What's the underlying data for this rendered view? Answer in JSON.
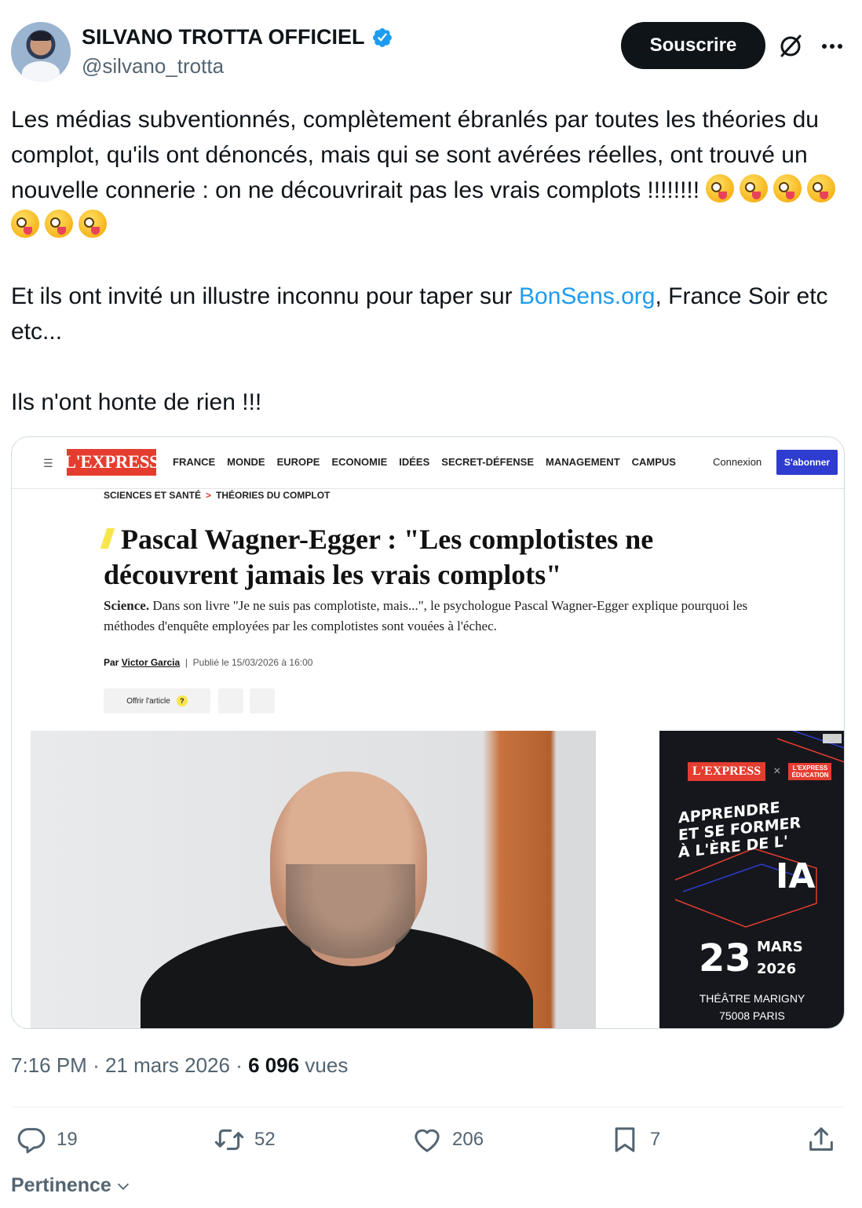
{
  "author": {
    "display_name": "SILVANO TROTTA OFFICIEL",
    "handle": "@silvano_trotta",
    "subscribe_label": "Souscrire"
  },
  "icons": {
    "verified": "verified-badge-icon",
    "grok": "grok-icon",
    "more": "more-icon",
    "reply": "reply-icon",
    "repost": "repost-icon",
    "like": "like-icon",
    "bookmark": "bookmark-icon",
    "share": "share-icon"
  },
  "colors": {
    "link": "#1d9bf0",
    "text": "#0f1419",
    "muted": "#536471",
    "button": "#0f1419"
  },
  "tweet": {
    "para1": "Les médias subventionnés, complètement ébranlés par toutes les théories du complot, qu'ils ont dénoncés, mais qui se sont avérées réelles, ont trouvé un nouvelle connerie : on ne découvrirait pas les vrais complots !!!!!!!!",
    "emoji_count": 7,
    "para2_before": "Et ils ont invité un illustre inconnu pour taper sur ",
    "para2_link": "BonSens.org",
    "para2_after": ", France Soir etc etc...",
    "para3": "Ils n'ont honte de rien !!!"
  },
  "article": {
    "logo": "L'EXPRESS",
    "nav": [
      "FRANCE",
      "MONDE",
      "EUROPE",
      "ECONOMIE",
      "IDÉES",
      "SECRET-DÉFENSE",
      "MANAGEMENT",
      "CAMPUS"
    ],
    "login": "Connexion",
    "subscribe": "S'abonner",
    "crumb1": "SCIENCES ET SANTÉ",
    "crumb_sep": ">",
    "crumb2": "THÉORIES DU COMPLOT",
    "title": "Pascal Wagner-Egger : \"Les complotistes ne découvrent jamais les vrais complots\"",
    "standfirst_label": "Science.",
    "standfirst": "Dans son livre \"Je ne suis pas complotiste, mais...\", le psychologue Pascal Wagner-Egger explique pourquoi les méthodes d'enquête employées par les complotistes sont vouées à l'échec.",
    "by_label": "Par",
    "author": "Victor Garcia",
    "published": "Publié le 15/03/2026 à 16:00",
    "offer": "Offrir l'article",
    "offer_help": "?"
  },
  "ad": {
    "logo1": "L'EXPRESS",
    "x": "×",
    "logo2_line1": "L'EXPRESS",
    "logo2_line2": "ÉDUCATION",
    "headline_1": "APPRENDRE",
    "headline_2": "ET SE FORMER",
    "headline_3": "À L'ÈRE DE L'",
    "ia": "IA",
    "day": "23",
    "month": "MARS",
    "year": "2026",
    "venue": "THÉÂTRE MARIGNY",
    "city": "75008 PARIS"
  },
  "meta": {
    "time": "7:16 PM",
    "sep": "·",
    "date": "21 mars 2026",
    "views_count": "6 096",
    "views_label": "vues"
  },
  "stats": {
    "replies": "19",
    "reposts": "52",
    "likes": "206",
    "bookmarks": "7"
  },
  "sort_label": "Pertinence"
}
